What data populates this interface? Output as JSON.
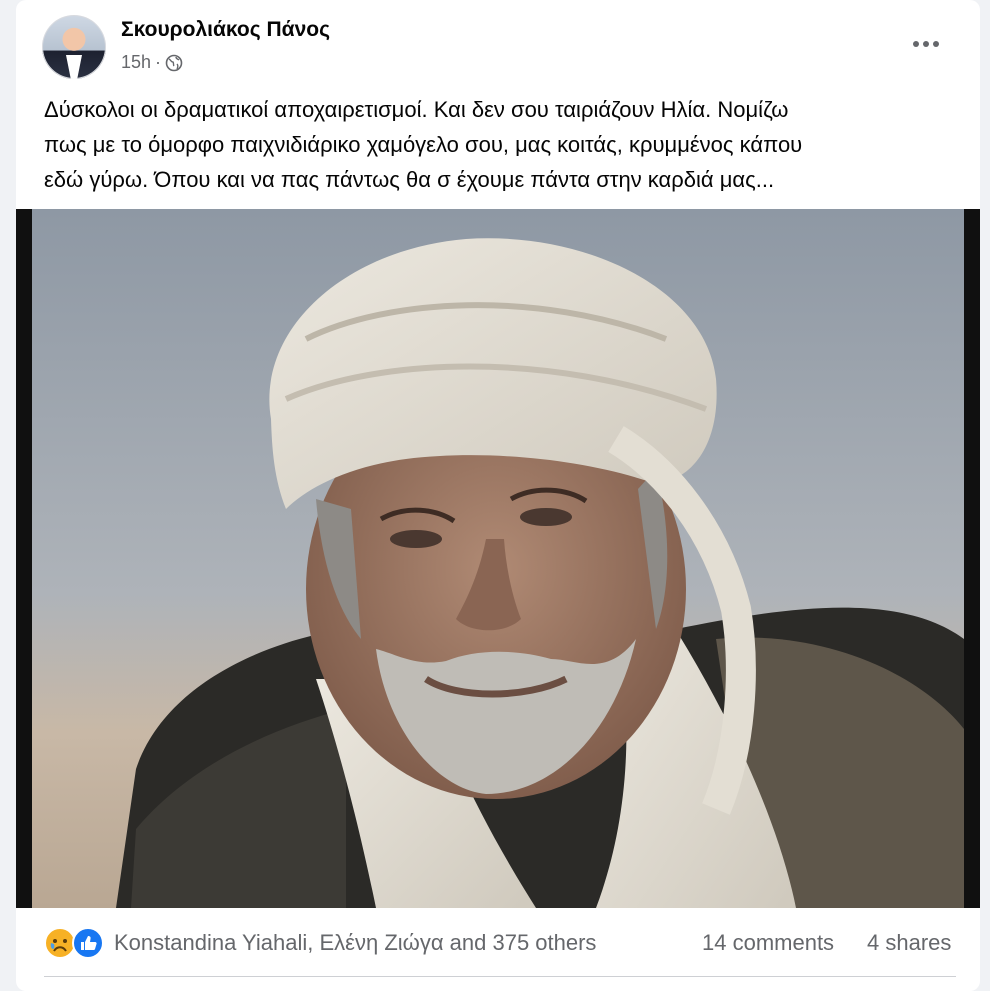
{
  "post": {
    "author": "Σκουρολιάκος Πάνος",
    "time": "15h",
    "time_separator": "·",
    "privacy_icon": "globe-icon",
    "more_icon": "more-options-icon",
    "text_lines": [
      "Δύσκολοι οι δραματικοί αποχαιρετισμοί. Και δεν σου ταιριάζουν Ηλία. Νομίζω",
      "πως με το όμορφο παιχνιδιάρικο χαμόγελο σου,  μας κοιτάς, κρυμμένος κάπου",
      "εδώ γύρω. Όπου και να πας πάντως θα σ έχουμε πάντα στην καρδιά μας..."
    ]
  },
  "reactions": {
    "icons": [
      "sad-reaction-icon",
      "like-reaction-icon"
    ],
    "names": "Konstandina Yiahali, Ελένη Ζιώγα and 375 others",
    "comments": "14 comments",
    "shares": "4 shares"
  },
  "colors": {
    "like_blue": "#1877f2",
    "sad_yellow": "#f7b125",
    "secondary_text": "#65676b"
  }
}
